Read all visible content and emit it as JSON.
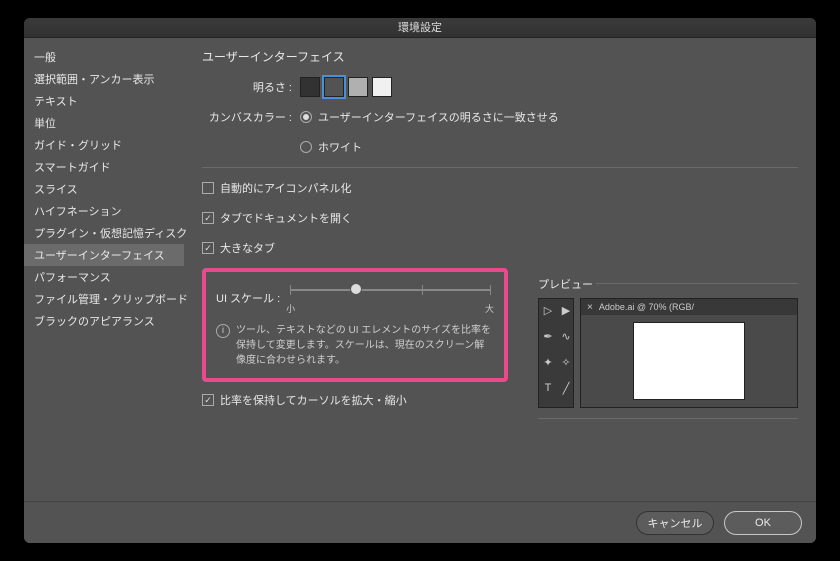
{
  "window": {
    "title": "環境設定"
  },
  "sidebar": {
    "items": [
      "一般",
      "選択範囲・アンカー表示",
      "テキスト",
      "単位",
      "ガイド・グリッド",
      "スマートガイド",
      "スライス",
      "ハイフネーション",
      "プラグイン・仮想記憶ディスク",
      "ユーザーインターフェイス",
      "パフォーマンス",
      "ファイル管理・クリップボード",
      "ブラックのアピアランス"
    ],
    "selected_index": 9
  },
  "main": {
    "section_title": "ユーザーインターフェイス",
    "brightness_label": "明るさ :",
    "swatches": [
      "#323232",
      "#535353",
      "#b0b0b0",
      "#f0f0f0"
    ],
    "swatch_selected": 1,
    "canvas_color_label": "カンバスカラー :",
    "canvas_options": [
      "ユーザーインターフェイスの明るさに一致させる",
      "ホワイト"
    ],
    "canvas_selected": 0,
    "checkboxes": [
      {
        "label": "自動的にアイコンパネル化",
        "checked": false
      },
      {
        "label": "タブでドキュメントを開く",
        "checked": true
      },
      {
        "label": "大きなタブ",
        "checked": true
      }
    ],
    "ui_scale_label": "UI スケール :",
    "slider_min": "小",
    "slider_max": "大",
    "info_text": "ツール、テキストなどの UI エレメントのサイズを比率を保持して変更します。スケールは、現在のスクリーン解像度に合わせられます。",
    "cursor_checkbox": {
      "label": "比率を保持してカーソルを拡大・縮小",
      "checked": true
    }
  },
  "preview": {
    "title": "プレビュー",
    "tab_label": "Adobe.ai @ 70% (RGB/"
  },
  "footer": {
    "cancel": "キャンセル",
    "ok": "OK"
  }
}
